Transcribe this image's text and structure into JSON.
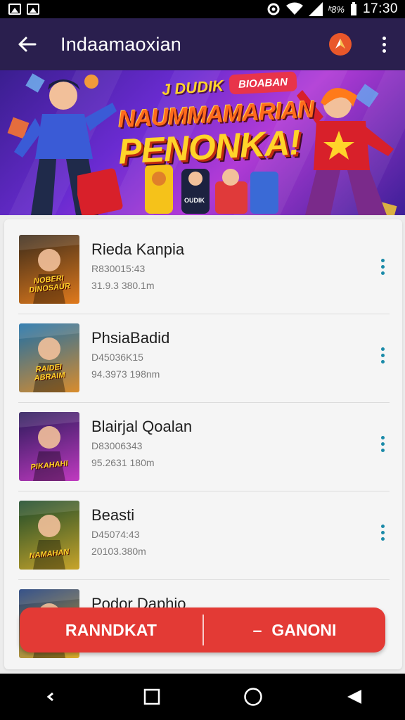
{
  "status_bar": {
    "battery_text": "ᴵᵗ8%",
    "time": "17:30",
    "icons": [
      "image-icon",
      "image-icon",
      "sync-icon",
      "wifi-icon",
      "signal-icon"
    ]
  },
  "app_bar": {
    "title": "Indaamaoxian",
    "back_icon": "arrow-left-icon",
    "logo_icon": "app-logo-icon",
    "more_icon": "more-vertical-icon"
  },
  "banner": {
    "tag": "J DUDIK",
    "badge": "BIOABAN",
    "line1": "NAUMMAMARIAN",
    "line2": "PENONKA!",
    "pill": "OUDIK"
  },
  "list": {
    "items": [
      {
        "title": "Rieda Kanpia",
        "sub1": "R830015:43",
        "sub2": "31.9.3 380.1m",
        "thumb_label": "NOBERI DINOSAUR",
        "thumb_colors": [
          "#3a2a1a",
          "#e07a1c"
        ]
      },
      {
        "title": "PhsiaBadid",
        "sub1": "D45036K15",
        "sub2": "94.3973 198nm",
        "thumb_label": "RAIDEI ABRAIM",
        "thumb_colors": [
          "#1c6fa8",
          "#d98c2c"
        ]
      },
      {
        "title": "Blairjal Qoalan",
        "sub1": "D83006343",
        "sub2": "95.2631 180m",
        "thumb_label": "PIKAHAHI",
        "thumb_colors": [
          "#2a1a5a",
          "#c03ac0"
        ]
      },
      {
        "title": "Beasti",
        "sub1": "D45074:43",
        "sub2": "20103.380m",
        "thumb_label": "NAMAHAN",
        "thumb_colors": [
          "#1b4a2a",
          "#c8a42a"
        ]
      },
      {
        "title": "Podor Daphio",
        "sub1": "",
        "sub2": "",
        "thumb_label": "",
        "thumb_colors": [
          "#1a3a7a",
          "#e0b02a"
        ]
      }
    ],
    "item_more_icon": "more-vertical-icon"
  },
  "action_bar": {
    "left_label": "RANNDKAT",
    "right_label": "GANONI",
    "right_prefix": "–",
    "color": "#e33a35"
  },
  "nav_bar": {
    "icons": [
      "back-chevron-icon",
      "recents-square-icon",
      "home-circle-icon",
      "back-triangle-icon"
    ]
  },
  "colors": {
    "app_bar": "#2a1f4e",
    "accent_dots": "#1a8aa8",
    "action": "#e33a35"
  }
}
